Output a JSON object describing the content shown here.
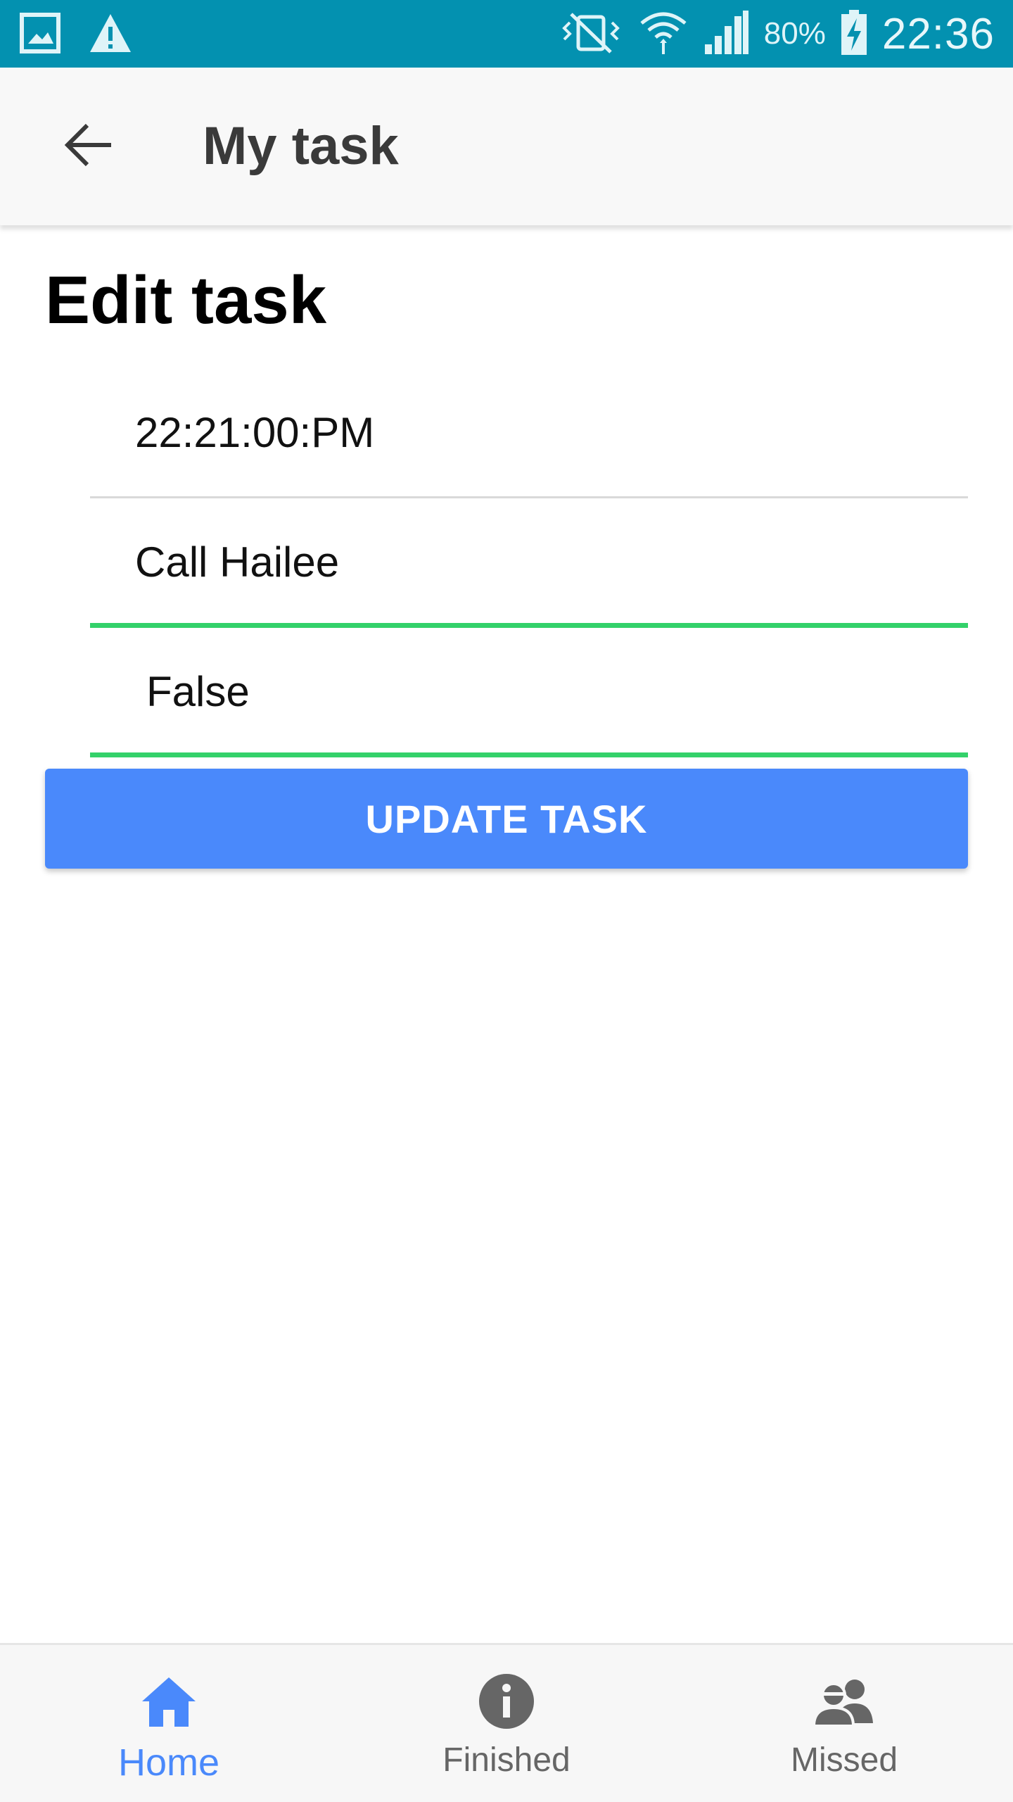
{
  "status_bar": {
    "battery": "80%",
    "time": "22:36",
    "icons": [
      "gallery-icon",
      "warning-icon",
      "vibrate-icon",
      "wifi-icon",
      "signal-icon",
      "battery-charging-icon"
    ]
  },
  "app_bar": {
    "title": "My task",
    "back_icon": "arrow-back-icon"
  },
  "form": {
    "heading": "Edit task",
    "time_value": "22:21:00:PM",
    "task_name_value": "Call Hailee",
    "status_value": "False",
    "update_label": "UPDATE TASK"
  },
  "bottom_nav": {
    "items": [
      {
        "label": "Home",
        "icon": "home-icon",
        "active": true
      },
      {
        "label": "Finished",
        "icon": "info-icon",
        "active": false
      },
      {
        "label": "Missed",
        "icon": "people-icon",
        "active": false
      }
    ]
  },
  "colors": {
    "status_bar": "#0391b0",
    "accent": "#4a89fb",
    "active_underline": "#33d16a"
  }
}
